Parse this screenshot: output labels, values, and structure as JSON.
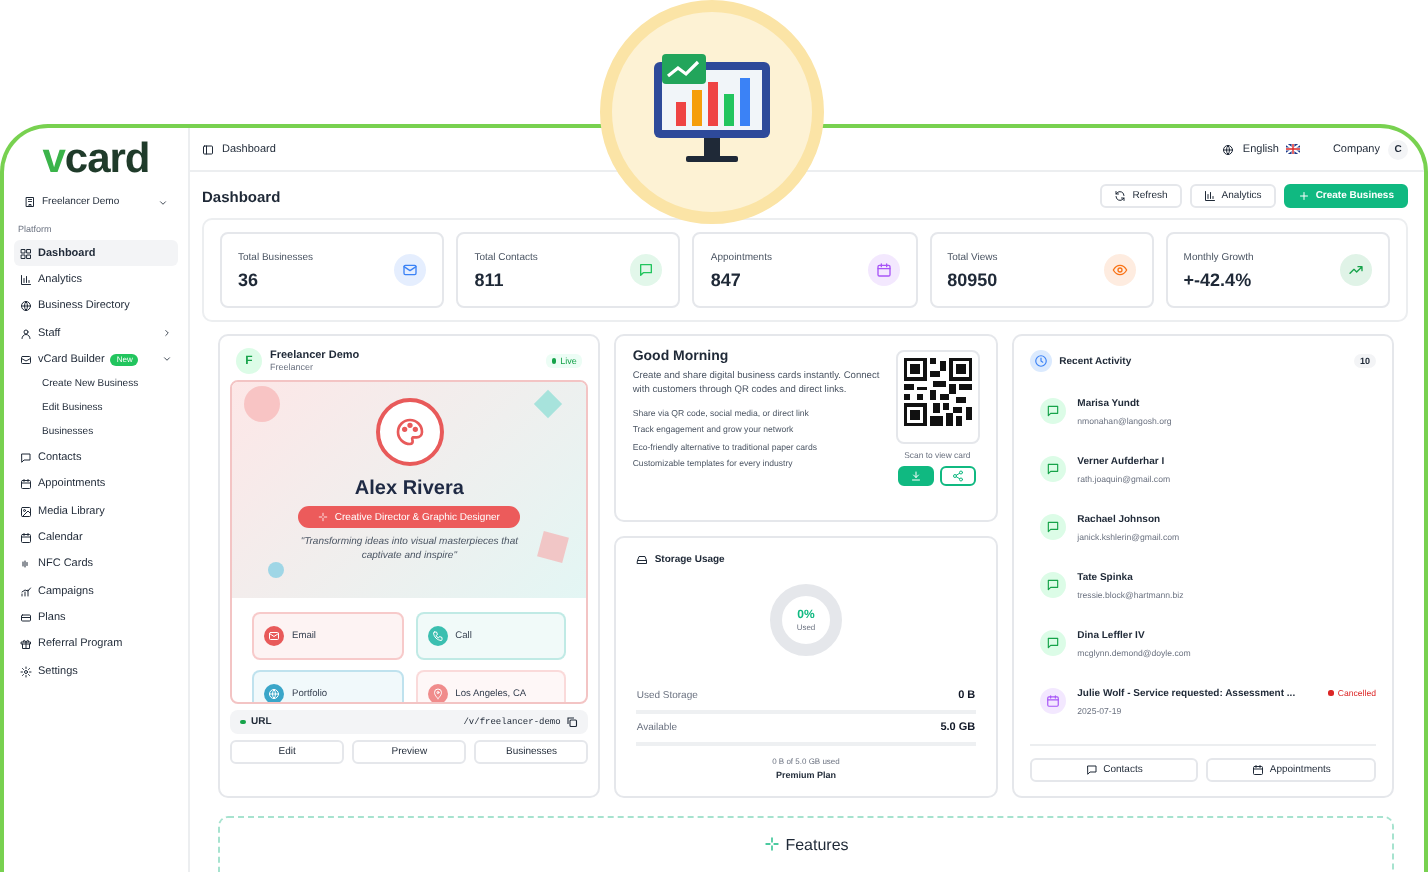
{
  "logo": {
    "accent": "v",
    "rest": "card"
  },
  "workspace": "Freelancer Demo",
  "sidebar": {
    "section": "Platform",
    "items": [
      {
        "label": "Dashboard",
        "selected": true
      },
      {
        "label": "Analytics",
        "selected": false
      },
      {
        "label": "Business Directory",
        "selected": false
      },
      {
        "label": "Staff",
        "selected": false,
        "expanded": false
      },
      {
        "label": "vCard Builder",
        "selected": false,
        "expanded": true,
        "badge": "New",
        "children": [
          {
            "label": "Create New Business",
            "selected": false
          },
          {
            "label": "Edit Business",
            "selected": false
          },
          {
            "label": "Businesses",
            "selected": false
          }
        ]
      },
      {
        "label": "Contacts",
        "selected": false
      },
      {
        "label": "Appointments",
        "selected": false
      },
      {
        "label": "Media Library",
        "selected": false
      },
      {
        "label": "Calendar",
        "selected": false
      },
      {
        "label": "NFC Cards",
        "selected": false
      },
      {
        "label": "Campaigns",
        "selected": false
      },
      {
        "label": "Plans",
        "selected": false
      },
      {
        "label": "Referral Program",
        "selected": false
      },
      {
        "label": "Settings",
        "selected": false
      }
    ]
  },
  "topbar": {
    "breadcrumb": "Dashboard",
    "language": "English",
    "company": "Company",
    "avatar": "C"
  },
  "header": {
    "title": "Dashboard",
    "buttons": [
      {
        "label": "Refresh",
        "kind": "outline"
      },
      {
        "label": "Analytics",
        "kind": "outline"
      },
      {
        "label": "Create Business",
        "kind": "primary"
      }
    ]
  },
  "stats": [
    {
      "label": "Total Businesses",
      "value": "36",
      "color": "#3b82f6"
    },
    {
      "label": "Total Contacts",
      "value": "811",
      "color": "#22c55e"
    },
    {
      "label": "Appointments",
      "value": "847",
      "color": "#a855f7"
    },
    {
      "label": "Total Views",
      "value": "80950",
      "color": "#f97316"
    },
    {
      "label": "Monthly Growth",
      "value": "+-42.4%",
      "color": "#16a34a"
    }
  ],
  "card_panel": {
    "avatar": "F",
    "name": "Freelancer Demo",
    "role": "Freelancer",
    "status": "Live",
    "preview": {
      "name": "Alex Rivera",
      "title": "Creative Director & Graphic Designer",
      "quote": "\"Transforming ideas into visual masterpieces that captivate and inspire\"",
      "contacts": [
        {
          "label": "Email",
          "color": "#e85a5a"
        },
        {
          "label": "Call",
          "color": "#3bbfb0"
        },
        {
          "label": "Portfolio",
          "color": "#3aa6c9"
        },
        {
          "label": "Los Angeles, CA",
          "color": "#f08c8c"
        }
      ]
    },
    "url_label": "URL",
    "url": "/v/freelancer-demo",
    "buttons": [
      "Edit",
      "Preview",
      "Businesses"
    ]
  },
  "greeting": {
    "title": "Good Morning",
    "text": "Create and share digital business cards instantly. Connect with customers through QR codes and direct links.",
    "features": [
      "Share via QR code, social media, or direct link",
      "Track engagement and grow your network",
      "Eco-friendly alternative to traditional paper cards",
      "Customizable templates for every industry"
    ],
    "qr_caption": "Scan to view card"
  },
  "storage": {
    "title": "Storage Usage",
    "percent": "0%",
    "percent_caption": "Used",
    "level": 0,
    "rows": [
      {
        "label": "Used Storage",
        "value": "0 B"
      },
      {
        "label": "Available",
        "value": "5.0 GB"
      }
    ],
    "summary": "0 B of 5.0 GB used",
    "plan": "Premium Plan"
  },
  "activity": {
    "title": "Recent Activity",
    "count": "10",
    "items": [
      {
        "kind": "contact",
        "name": "Marisa Yundt",
        "detail": "nmonahan@langosh.org"
      },
      {
        "kind": "contact",
        "name": "Verner Aufderhar I",
        "detail": "rath.joaquin@gmail.com"
      },
      {
        "kind": "contact",
        "name": "Rachael Johnson",
        "detail": "janick.kshlerin@gmail.com"
      },
      {
        "kind": "contact",
        "name": "Tate Spinka",
        "detail": "tressie.block@hartmann.biz"
      },
      {
        "kind": "contact",
        "name": "Dina Leffler IV",
        "detail": "mcglynn.demond@doyle.com"
      },
      {
        "kind": "appointment",
        "name": "Julie Wolf - Service requested: Assessment ...",
        "detail": "2025-07-19",
        "status": "Cancelled"
      }
    ],
    "buttons": [
      "Contacts",
      "Appointments"
    ]
  },
  "features": {
    "title": "Features"
  }
}
